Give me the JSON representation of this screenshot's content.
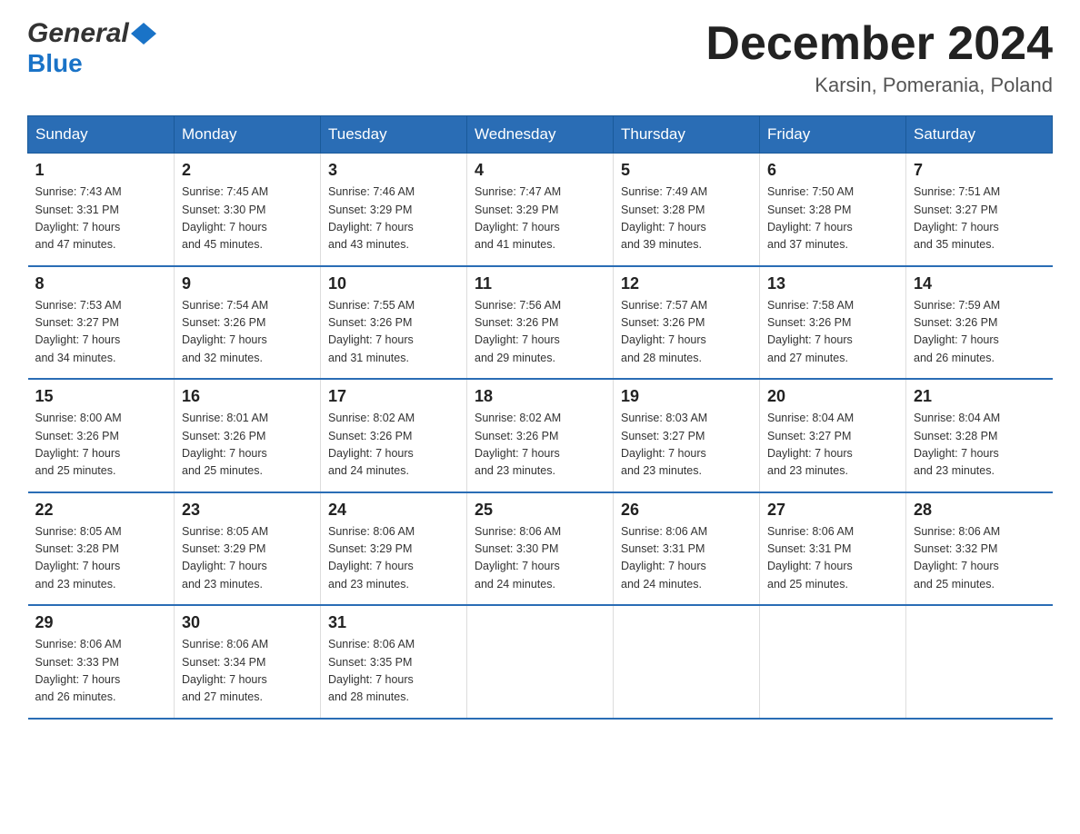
{
  "header": {
    "logo_general": "General",
    "logo_blue": "Blue",
    "month_title": "December 2024",
    "location": "Karsin, Pomerania, Poland"
  },
  "days_of_week": [
    "Sunday",
    "Monday",
    "Tuesday",
    "Wednesday",
    "Thursday",
    "Friday",
    "Saturday"
  ],
  "weeks": [
    [
      {
        "day": "1",
        "sunrise": "7:43 AM",
        "sunset": "3:31 PM",
        "daylight": "7 hours and 47 minutes."
      },
      {
        "day": "2",
        "sunrise": "7:45 AM",
        "sunset": "3:30 PM",
        "daylight": "7 hours and 45 minutes."
      },
      {
        "day": "3",
        "sunrise": "7:46 AM",
        "sunset": "3:29 PM",
        "daylight": "7 hours and 43 minutes."
      },
      {
        "day": "4",
        "sunrise": "7:47 AM",
        "sunset": "3:29 PM",
        "daylight": "7 hours and 41 minutes."
      },
      {
        "day": "5",
        "sunrise": "7:49 AM",
        "sunset": "3:28 PM",
        "daylight": "7 hours and 39 minutes."
      },
      {
        "day": "6",
        "sunrise": "7:50 AM",
        "sunset": "3:28 PM",
        "daylight": "7 hours and 37 minutes."
      },
      {
        "day": "7",
        "sunrise": "7:51 AM",
        "sunset": "3:27 PM",
        "daylight": "7 hours and 35 minutes."
      }
    ],
    [
      {
        "day": "8",
        "sunrise": "7:53 AM",
        "sunset": "3:27 PM",
        "daylight": "7 hours and 34 minutes."
      },
      {
        "day": "9",
        "sunrise": "7:54 AM",
        "sunset": "3:26 PM",
        "daylight": "7 hours and 32 minutes."
      },
      {
        "day": "10",
        "sunrise": "7:55 AM",
        "sunset": "3:26 PM",
        "daylight": "7 hours and 31 minutes."
      },
      {
        "day": "11",
        "sunrise": "7:56 AM",
        "sunset": "3:26 PM",
        "daylight": "7 hours and 29 minutes."
      },
      {
        "day": "12",
        "sunrise": "7:57 AM",
        "sunset": "3:26 PM",
        "daylight": "7 hours and 28 minutes."
      },
      {
        "day": "13",
        "sunrise": "7:58 AM",
        "sunset": "3:26 PM",
        "daylight": "7 hours and 27 minutes."
      },
      {
        "day": "14",
        "sunrise": "7:59 AM",
        "sunset": "3:26 PM",
        "daylight": "7 hours and 26 minutes."
      }
    ],
    [
      {
        "day": "15",
        "sunrise": "8:00 AM",
        "sunset": "3:26 PM",
        "daylight": "7 hours and 25 minutes."
      },
      {
        "day": "16",
        "sunrise": "8:01 AM",
        "sunset": "3:26 PM",
        "daylight": "7 hours and 25 minutes."
      },
      {
        "day": "17",
        "sunrise": "8:02 AM",
        "sunset": "3:26 PM",
        "daylight": "7 hours and 24 minutes."
      },
      {
        "day": "18",
        "sunrise": "8:02 AM",
        "sunset": "3:26 PM",
        "daylight": "7 hours and 23 minutes."
      },
      {
        "day": "19",
        "sunrise": "8:03 AM",
        "sunset": "3:27 PM",
        "daylight": "7 hours and 23 minutes."
      },
      {
        "day": "20",
        "sunrise": "8:04 AM",
        "sunset": "3:27 PM",
        "daylight": "7 hours and 23 minutes."
      },
      {
        "day": "21",
        "sunrise": "8:04 AM",
        "sunset": "3:28 PM",
        "daylight": "7 hours and 23 minutes."
      }
    ],
    [
      {
        "day": "22",
        "sunrise": "8:05 AM",
        "sunset": "3:28 PM",
        "daylight": "7 hours and 23 minutes."
      },
      {
        "day": "23",
        "sunrise": "8:05 AM",
        "sunset": "3:29 PM",
        "daylight": "7 hours and 23 minutes."
      },
      {
        "day": "24",
        "sunrise": "8:06 AM",
        "sunset": "3:29 PM",
        "daylight": "7 hours and 23 minutes."
      },
      {
        "day": "25",
        "sunrise": "8:06 AM",
        "sunset": "3:30 PM",
        "daylight": "7 hours and 24 minutes."
      },
      {
        "day": "26",
        "sunrise": "8:06 AM",
        "sunset": "3:31 PM",
        "daylight": "7 hours and 24 minutes."
      },
      {
        "day": "27",
        "sunrise": "8:06 AM",
        "sunset": "3:31 PM",
        "daylight": "7 hours and 25 minutes."
      },
      {
        "day": "28",
        "sunrise": "8:06 AM",
        "sunset": "3:32 PM",
        "daylight": "7 hours and 25 minutes."
      }
    ],
    [
      {
        "day": "29",
        "sunrise": "8:06 AM",
        "sunset": "3:33 PM",
        "daylight": "7 hours and 26 minutes."
      },
      {
        "day": "30",
        "sunrise": "8:06 AM",
        "sunset": "3:34 PM",
        "daylight": "7 hours and 27 minutes."
      },
      {
        "day": "31",
        "sunrise": "8:06 AM",
        "sunset": "3:35 PM",
        "daylight": "7 hours and 28 minutes."
      },
      null,
      null,
      null,
      null
    ]
  ],
  "labels": {
    "sunrise": "Sunrise:",
    "sunset": "Sunset:",
    "daylight": "Daylight:"
  }
}
